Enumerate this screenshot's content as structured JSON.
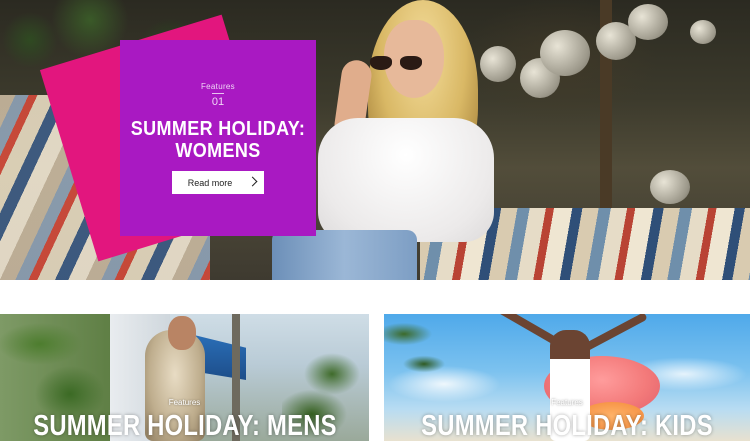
{
  "hero": {
    "kicker": "Features",
    "number": "01",
    "title_line1": "SUMMER HOLIDAY:",
    "title_line2": "WOMENS",
    "button_label": "Read more",
    "button_icon": "chevron-right-icon",
    "panel_colors": {
      "front": "#a919c2",
      "back": "#e2167e"
    }
  },
  "tiles": [
    {
      "kicker": "Features",
      "title": "SUMMER HOLIDAY: MENS"
    },
    {
      "kicker": "Features",
      "title": "SUMMER HOLIDAY: KIDS"
    }
  ]
}
